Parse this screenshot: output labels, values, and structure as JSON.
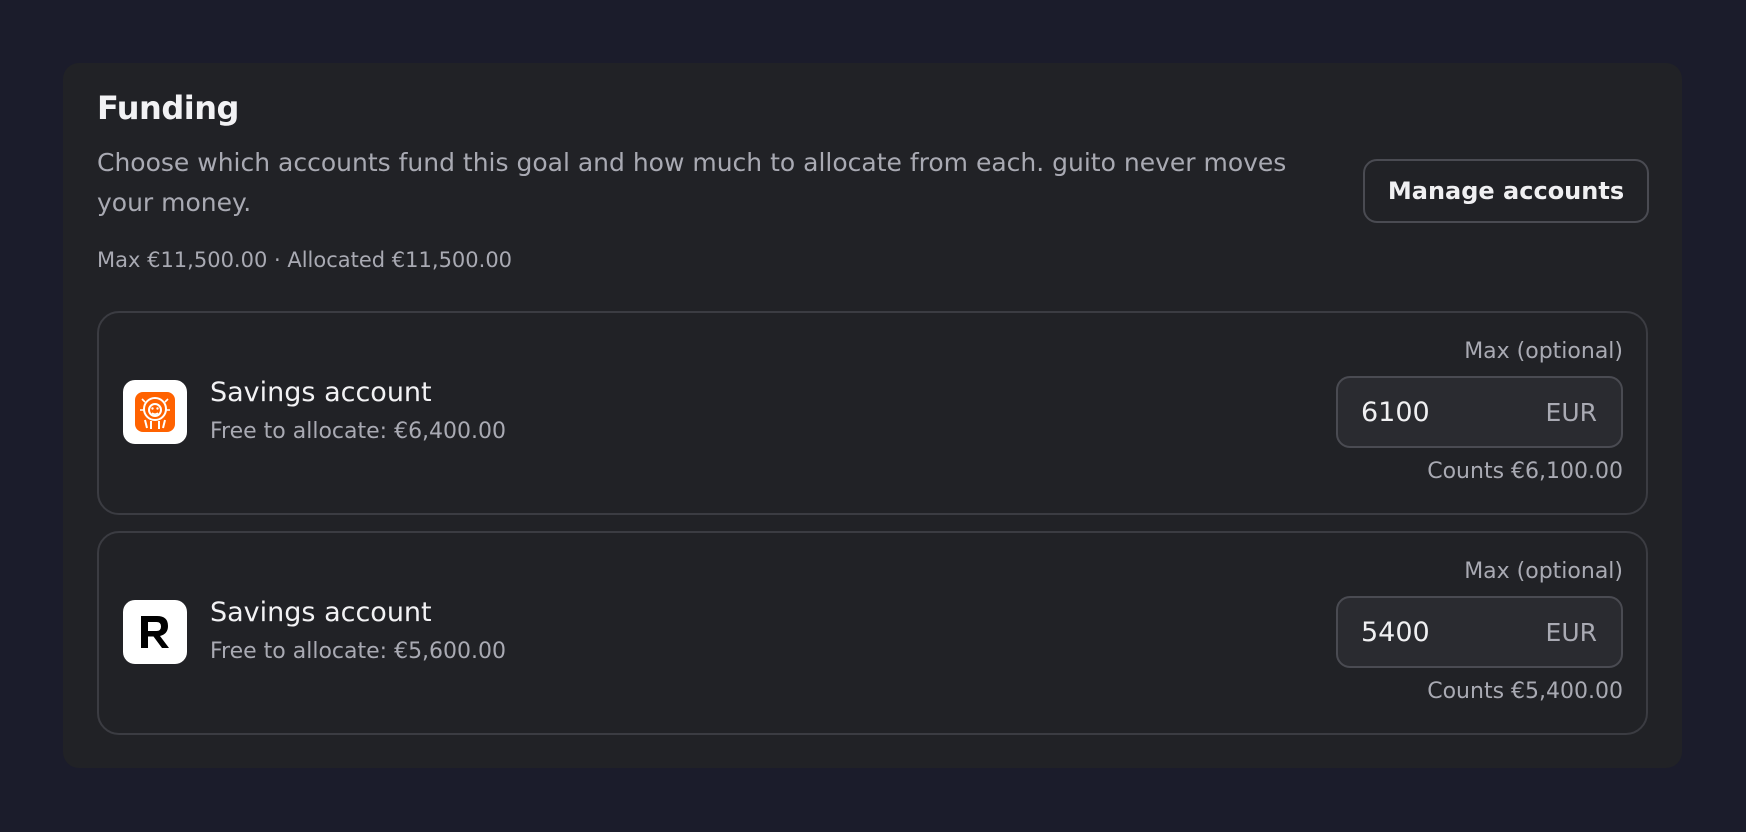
{
  "funding": {
    "title": "Funding",
    "description": "Choose which accounts fund this goal and how much to allocate from each. guito never moves your money.",
    "manage_label": "Manage accounts",
    "summary": "Max €11,500.00 · Allocated €11,500.00"
  },
  "accounts": [
    {
      "logo": "ing-lion-icon",
      "logo_color": "#ff6200",
      "name": "Savings account",
      "free": "Free to allocate: €6,400.00",
      "max_label": "Max (optional)",
      "amount": "6100",
      "currency": "EUR",
      "counts": "Counts €6,100.00"
    },
    {
      "logo": "revolut-r-icon",
      "logo_color": "#000000",
      "name": "Savings account",
      "free": "Free to allocate: €5,600.00",
      "max_label": "Max (optional)",
      "amount": "5400",
      "currency": "EUR",
      "counts": "Counts €5,400.00"
    }
  ]
}
